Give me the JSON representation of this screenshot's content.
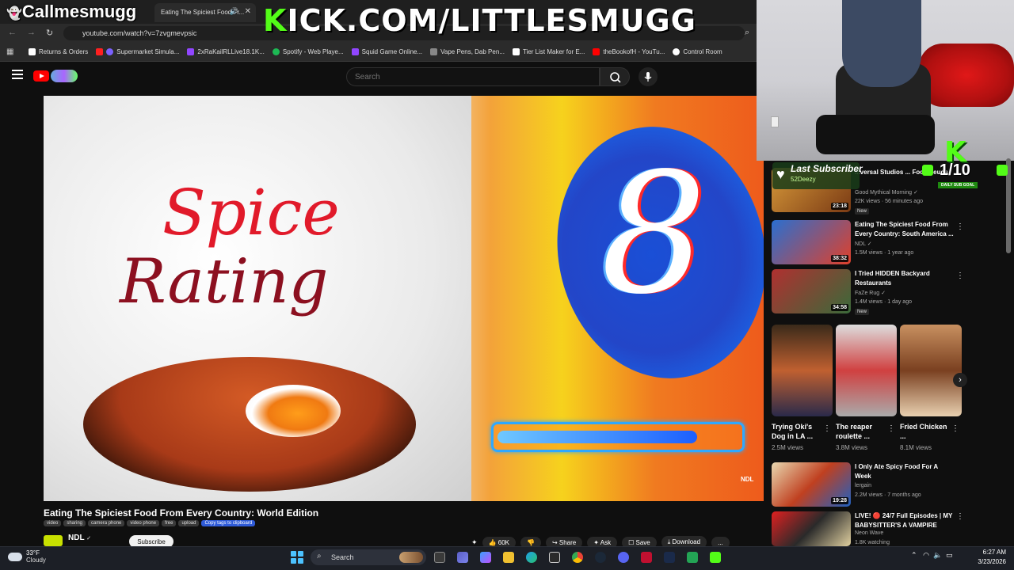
{
  "stream": {
    "username": "Callmesmugg",
    "banner_prefix": "K",
    "banner_rest": "ICK.COM/LITTLESMUGG"
  },
  "browser": {
    "tab_title": "Eating The Spiciest Food Fr...",
    "url": "youtube.com/watch?v=7zvgmevpsic",
    "bookmarks": [
      {
        "label": "Returns & Orders",
        "color": "#ffffff"
      },
      {
        "label": "Supermarket Simula...",
        "color": "#7b61ff"
      },
      {
        "label": "2xRaKailRLLive18.1K...",
        "color": "#9146ff"
      },
      {
        "label": "Spotify - Web Playe...",
        "color": "#1db954"
      },
      {
        "label": "Squid Game Online...",
        "color": "#9146ff"
      },
      {
        "label": "Vape Pens, Dab Pen...",
        "color": "#888888"
      },
      {
        "label": "Tier List Maker for E...",
        "color": "#ffffff"
      },
      {
        "label": "theBookofH - YouTu...",
        "color": "#ff0000"
      },
      {
        "label": "Control Room",
        "color": "#ffffff"
      }
    ]
  },
  "youtube": {
    "search_placeholder": "Search",
    "thumbnail": {
      "title_line1": "Spice",
      "title_line2": "Rating",
      "rating": "8",
      "rating_fraction": 0.83,
      "watermark": "NDL"
    },
    "video": {
      "title": "Eating The Spiciest Food From Every Country: World Edition",
      "tags": [
        "video",
        "sharing",
        "camera phone",
        "video phone",
        "free",
        "upload"
      ],
      "copy_tags_label": "Copy tags to clipboard",
      "channel": "NDL",
      "subscribe_label": "Subscribe",
      "likes": "60K",
      "share_label": "Share",
      "ask_label": "Ask",
      "save_label": "Save",
      "download_label": "Download",
      "more_label": "..."
    },
    "recommendations": [
      {
        "title": "...versal Studios ... Food Feuds",
        "channel": "Good Mythical Morning",
        "meta": "22K views · 56 minutes ago",
        "duration": "23:18",
        "badge": "New"
      },
      {
        "title": "Eating The Spiciest Food From Every Country: South America ...",
        "channel": "NDL",
        "meta": "1.5M views · 1 year ago",
        "duration": "38:32",
        "badge": ""
      },
      {
        "title": "I Tried HIDDEN Backyard Restaurants",
        "channel": "FaZe Rug",
        "meta": "1.4M views · 1 day ago",
        "duration": "34:58",
        "badge": "New"
      },
      {
        "title": "I Only Ate Spicy Food For A Week",
        "channel": "lergain",
        "meta": "2.2M views · 7 months ago",
        "duration": "19:28",
        "badge": ""
      },
      {
        "title": "LIVE! 🔴 24/7 Full Episodes | MY BABYSITTER'S A VAMPIRE",
        "channel": "Neon Wave",
        "meta": "1.8K watching",
        "duration": "",
        "badge": ""
      }
    ],
    "shorts": [
      {
        "title": "Trying Oki's Dog in LA ...",
        "views": "2.5M views"
      },
      {
        "title": "The reaper roulette ...",
        "views": "3.8M views"
      },
      {
        "title": "Fried Chicken ...",
        "views": "8.1M views"
      }
    ]
  },
  "overlay": {
    "last_sub_title": "Last Subscriber",
    "last_sub_name": "52Deezy",
    "goal_letter": "K",
    "goal_count": "1/10",
    "goal_label": "DAILY SUB GOAL"
  },
  "taskbar": {
    "temp": "33°F",
    "condition": "Cloudy",
    "search_label": "Search",
    "time": "6:27 AM",
    "date": "3/23/2026"
  }
}
